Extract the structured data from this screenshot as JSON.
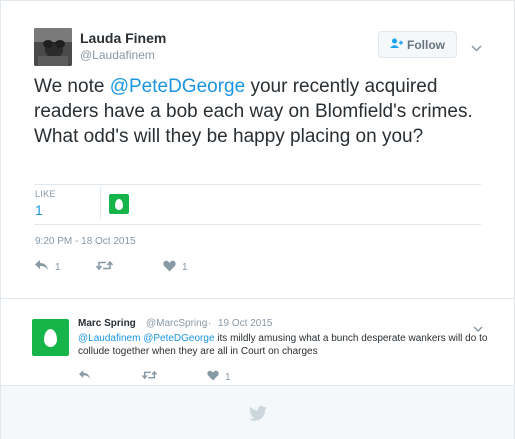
{
  "tweet": {
    "author_name": "Lauda Finem",
    "author_handle": "@Laudafinem",
    "follow_label": "Follow",
    "text_part1": "We note ",
    "text_mention": "@PeteDGeorge",
    "text_part2": " your recently acquired readers have a bob each way on Blomfield's crimes. What odd's will they be happy placing on you?",
    "like_label": "LIKE",
    "like_count": "1",
    "timestamp": "9:20 PM - 18 Oct 2015",
    "reply_count": "1",
    "heart_count": "1"
  },
  "reply": {
    "author_name": "Marc Spring",
    "author_handle": "@MarcSpring",
    "dot": "·",
    "date": "19 Oct 2015",
    "mention1": "@Laudafinem",
    "mention2": "@PeteDGeorge",
    "text": " its mildly amusing what a bunch desperate wankers will do to collude together when they are all in Court on charges",
    "heart_count": "1"
  },
  "colors": {
    "accent": "#1b95e0",
    "egg_green": "#16b449",
    "muted": "#8899a6"
  },
  "icons": [
    "follow-person-icon",
    "chevron-down-icon",
    "reply-icon",
    "retweet-icon",
    "heart-icon",
    "twitter-bird-icon"
  ]
}
